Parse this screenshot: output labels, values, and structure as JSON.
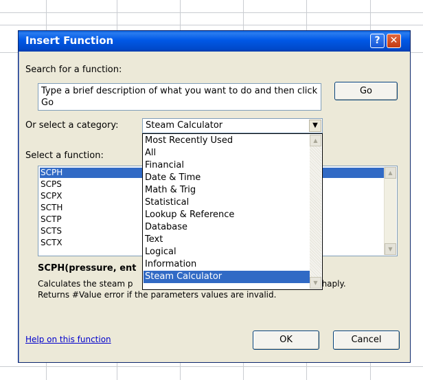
{
  "dialog": {
    "title": "Insert Function",
    "help_button": "?",
    "close_button": "✕"
  },
  "search": {
    "label": "Search for a function:",
    "value": "Type a brief description of what you want to do and then click Go",
    "go_label": "Go"
  },
  "category": {
    "label": "Or select a category:",
    "selected": "Steam Calculator",
    "options": [
      "Most Recently Used",
      "All",
      "Financial",
      "Date & Time",
      "Math & Trig",
      "Statistical",
      "Lookup & Reference",
      "Database",
      "Text",
      "Logical",
      "Information",
      "Steam Calculator"
    ]
  },
  "functions": {
    "label": "Select a function:",
    "items": [
      "SCPH",
      "SCPS",
      "SCPX",
      "SCTH",
      "SCTP",
      "SCTS",
      "SCTX"
    ],
    "selected": "SCPH"
  },
  "details": {
    "signature": "SCPH(pressure, ent",
    "description_line1_start": "Calculates the steam p",
    "description_line1_end": "d enthaply.",
    "description_line2": "Returns #Value error if the parameters values are invalid."
  },
  "footer": {
    "help_link": "Help on this function",
    "ok_label": "OK",
    "cancel_label": "Cancel"
  },
  "colors": {
    "titlebar": "#0058e6",
    "selection": "#316ac5",
    "dialog_bg": "#ece9d8"
  }
}
